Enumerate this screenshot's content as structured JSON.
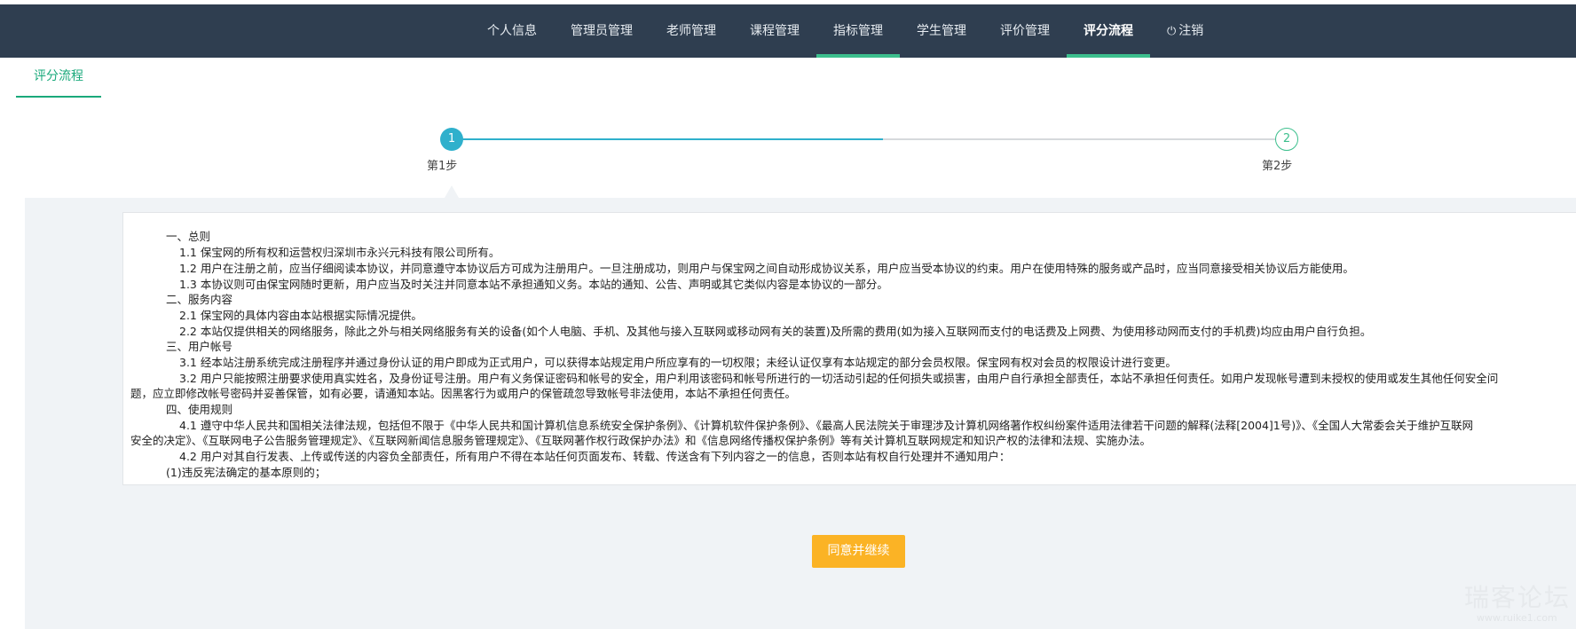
{
  "nav": {
    "items": [
      {
        "label": "个人信息"
      },
      {
        "label": "管理员管理"
      },
      {
        "label": "老师管理"
      },
      {
        "label": "课程管理"
      },
      {
        "label": "指标管理"
      },
      {
        "label": "学生管理"
      },
      {
        "label": "评价管理"
      },
      {
        "label": "评分流程"
      },
      {
        "label": "注销",
        "icon": "power-icon"
      }
    ],
    "active_index": 7,
    "hover_index": 4,
    "bar_color": "#2f3e50",
    "accent_color": "#3cbf8d"
  },
  "subtab": {
    "label": "评分流程"
  },
  "steps": [
    {
      "number": "1",
      "label": "第1步",
      "state": "active"
    },
    {
      "number": "2",
      "label": "第2步",
      "state": "pending"
    }
  ],
  "step_progress": 0.5,
  "agreement": {
    "lines": [
      "一、总则",
      "1.1 保宝网的所有权和运营权归深圳市永兴元科技有限公司所有。",
      "1.2 用户在注册之前，应当仔细阅读本协议，并同意遵守本协议后方可成为注册用户。一旦注册成功，则用户与保宝网之间自动形成协议关系，用户应当受本协议的约束。用户在使用特殊的服务或产品时，应当同意接受相关协议后方能使用。",
      "1.3 本协议则可由保宝网随时更新，用户应当及时关注并同意本站不承担通知义务。本站的通知、公告、声明或其它类似内容是本协议的一部分。",
      "二、服务内容",
      "2.1 保宝网的具体内容由本站根据实际情况提供。",
      "2.2 本站仅提供相关的网络服务，除此之外与相关网络服务有关的设备(如个人电脑、手机、及其他与接入互联网或移动网有关的装置)及所需的费用(如为接入互联网而支付的电话费及上网费、为使用移动网而支付的手机费)均应由用户自行负担。",
      "三、用户帐号",
      "3.1 经本站注册系统完成注册程序并通过身份认证的用户即成为正式用户，可以获得本站规定用户所应享有的一切权限；未经认证仅享有本站规定的部分会员权限。保宝网有权对会员的权限设计进行变更。",
      "3.2 用户只能按照注册要求使用真实姓名，及身份证号注册。用户有义务保证密码和帐号的安全，用户利用该密码和帐号所进行的一切活动引起的任何损失或损害，由用户自行承担全部责任，本站不承担任何责任。如用户发现帐号遭到未授权的使用或发生其他任何安全问",
      "题，应立即修改帐号密码并妥善保管，如有必要，请通知本站。因黑客行为或用户的保管疏忽导致帐号非法使用，本站不承担任何责任。",
      "四、使用规则",
      "4.1 遵守中华人民共和国相关法律法规，包括但不限于《中华人民共和国计算机信息系统安全保护条例》、《计算机软件保护条例》、《最高人民法院关于审理涉及计算机网络著作权纠纷案件适用法律若干问题的解释(法释[2004]1号)》、《全国人大常委会关于维护互联网",
      "安全的决定》、《互联网电子公告服务管理规定》、《互联网新闻信息服务管理规定》、《互联网著作权行政保护办法》和《信息网络传播权保护条例》等有关计算机互联网规定和知识产权的法律和法规、实施办法。",
      "4.2 用户对其自行发表、上传或传送的内容负全部责任，所有用户不得在本站任何页面发布、转载、传送含有下列内容之一的信息，否则本站有权自行处理并不通知用户：",
      "(1)违反宪法确定的基本原则的；"
    ]
  },
  "agree_button": {
    "label": "同意并继续",
    "color": "#fbb325"
  },
  "watermark": {
    "text": "瑞客论坛",
    "url": "www.ruike1.com"
  }
}
